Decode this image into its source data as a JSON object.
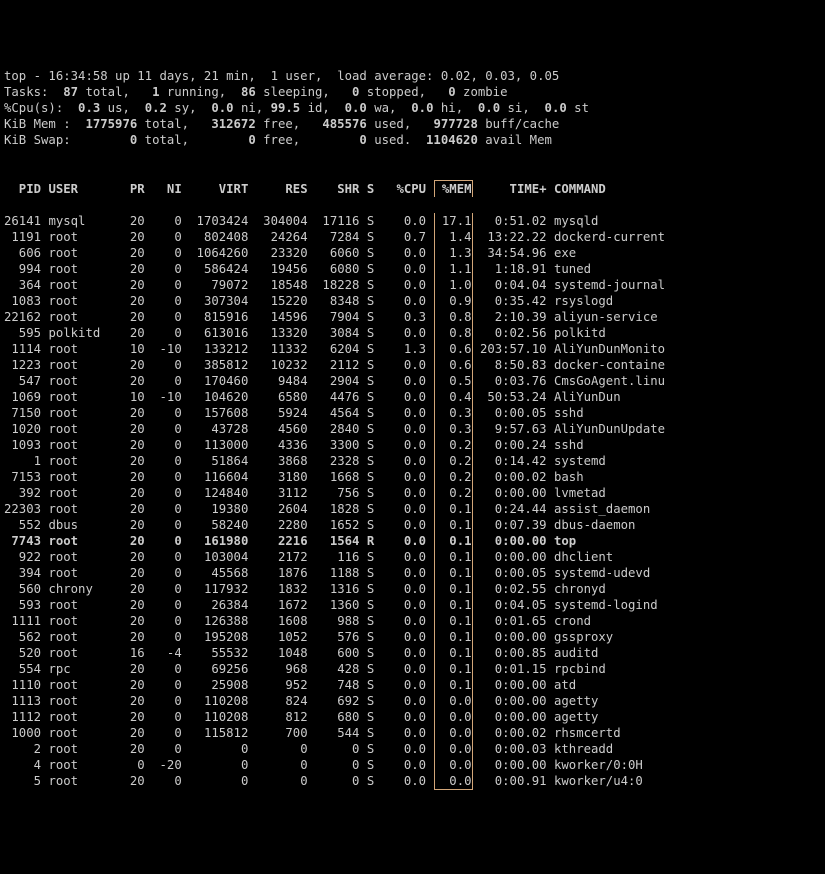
{
  "summary": {
    "top_line": {
      "time": "16:34:58",
      "uptime": "11 days, 21 min",
      "users": "1 user",
      "load": "0.02, 0.03, 0.05"
    },
    "tasks": {
      "total": "87",
      "running": "1",
      "sleeping": "86",
      "stopped": "0",
      "zombie": "0"
    },
    "cpu": {
      "us": "0.3",
      "sy": "0.2",
      "ni": "0.0",
      "id": "99.5",
      "wa": "0.0",
      "hi": "0.0",
      "si": "0.0",
      "st": "0.0"
    },
    "mem": {
      "total": "1775976",
      "free": "312672",
      "used": "485576",
      "buff": "977728"
    },
    "swap": {
      "total": "0",
      "free": "0",
      "used": "0",
      "avail": "1104620"
    }
  },
  "columns": [
    "PID",
    "USER",
    "PR",
    "NI",
    "VIRT",
    "RES",
    "SHR",
    "S",
    "%CPU",
    "%MEM",
    "TIME+",
    "COMMAND"
  ],
  "processes": [
    {
      "pid": "26141",
      "user": "mysql",
      "pr": "20",
      "ni": "0",
      "virt": "1703424",
      "res": "304004",
      "shr": "17116",
      "s": "S",
      "cpu": "0.0",
      "mem": "17.1",
      "time": "0:51.02",
      "cmd": "mysqld"
    },
    {
      "pid": "1191",
      "user": "root",
      "pr": "20",
      "ni": "0",
      "virt": "802408",
      "res": "24264",
      "shr": "7284",
      "s": "S",
      "cpu": "0.7",
      "mem": "1.4",
      "time": "13:22.22",
      "cmd": "dockerd-current"
    },
    {
      "pid": "606",
      "user": "root",
      "pr": "20",
      "ni": "0",
      "virt": "1064260",
      "res": "23320",
      "shr": "6060",
      "s": "S",
      "cpu": "0.0",
      "mem": "1.3",
      "time": "34:54.96",
      "cmd": "exe"
    },
    {
      "pid": "994",
      "user": "root",
      "pr": "20",
      "ni": "0",
      "virt": "586424",
      "res": "19456",
      "shr": "6080",
      "s": "S",
      "cpu": "0.0",
      "mem": "1.1",
      "time": "1:18.91",
      "cmd": "tuned"
    },
    {
      "pid": "364",
      "user": "root",
      "pr": "20",
      "ni": "0",
      "virt": "79072",
      "res": "18548",
      "shr": "18228",
      "s": "S",
      "cpu": "0.0",
      "mem": "1.0",
      "time": "0:04.04",
      "cmd": "systemd-journal"
    },
    {
      "pid": "1083",
      "user": "root",
      "pr": "20",
      "ni": "0",
      "virt": "307304",
      "res": "15220",
      "shr": "8348",
      "s": "S",
      "cpu": "0.0",
      "mem": "0.9",
      "time": "0:35.42",
      "cmd": "rsyslogd"
    },
    {
      "pid": "22162",
      "user": "root",
      "pr": "20",
      "ni": "0",
      "virt": "815916",
      "res": "14596",
      "shr": "7904",
      "s": "S",
      "cpu": "0.3",
      "mem": "0.8",
      "time": "2:10.39",
      "cmd": "aliyun-service"
    },
    {
      "pid": "595",
      "user": "polkitd",
      "pr": "20",
      "ni": "0",
      "virt": "613016",
      "res": "13320",
      "shr": "3084",
      "s": "S",
      "cpu": "0.0",
      "mem": "0.8",
      "time": "0:02.56",
      "cmd": "polkitd"
    },
    {
      "pid": "1114",
      "user": "root",
      "pr": "10",
      "ni": "-10",
      "virt": "133212",
      "res": "11332",
      "shr": "6204",
      "s": "S",
      "cpu": "1.3",
      "mem": "0.6",
      "time": "203:57.10",
      "cmd": "AliYunDunMonito"
    },
    {
      "pid": "1223",
      "user": "root",
      "pr": "20",
      "ni": "0",
      "virt": "385812",
      "res": "10232",
      "shr": "2112",
      "s": "S",
      "cpu": "0.0",
      "mem": "0.6",
      "time": "8:50.83",
      "cmd": "docker-containe"
    },
    {
      "pid": "547",
      "user": "root",
      "pr": "20",
      "ni": "0",
      "virt": "170460",
      "res": "9484",
      "shr": "2904",
      "s": "S",
      "cpu": "0.0",
      "mem": "0.5",
      "time": "0:03.76",
      "cmd": "CmsGoAgent.linu"
    },
    {
      "pid": "1069",
      "user": "root",
      "pr": "10",
      "ni": "-10",
      "virt": "104620",
      "res": "6580",
      "shr": "4476",
      "s": "S",
      "cpu": "0.0",
      "mem": "0.4",
      "time": "50:53.24",
      "cmd": "AliYunDun"
    },
    {
      "pid": "7150",
      "user": "root",
      "pr": "20",
      "ni": "0",
      "virt": "157608",
      "res": "5924",
      "shr": "4564",
      "s": "S",
      "cpu": "0.0",
      "mem": "0.3",
      "time": "0:00.05",
      "cmd": "sshd"
    },
    {
      "pid": "1020",
      "user": "root",
      "pr": "20",
      "ni": "0",
      "virt": "43728",
      "res": "4560",
      "shr": "2840",
      "s": "S",
      "cpu": "0.0",
      "mem": "0.3",
      "time": "9:57.63",
      "cmd": "AliYunDunUpdate"
    },
    {
      "pid": "1093",
      "user": "root",
      "pr": "20",
      "ni": "0",
      "virt": "113000",
      "res": "4336",
      "shr": "3300",
      "s": "S",
      "cpu": "0.0",
      "mem": "0.2",
      "time": "0:00.24",
      "cmd": "sshd"
    },
    {
      "pid": "1",
      "user": "root",
      "pr": "20",
      "ni": "0",
      "virt": "51864",
      "res": "3868",
      "shr": "2328",
      "s": "S",
      "cpu": "0.0",
      "mem": "0.2",
      "time": "0:14.42",
      "cmd": "systemd"
    },
    {
      "pid": "7153",
      "user": "root",
      "pr": "20",
      "ni": "0",
      "virt": "116604",
      "res": "3180",
      "shr": "1668",
      "s": "S",
      "cpu": "0.0",
      "mem": "0.2",
      "time": "0:00.02",
      "cmd": "bash"
    },
    {
      "pid": "392",
      "user": "root",
      "pr": "20",
      "ni": "0",
      "virt": "124840",
      "res": "3112",
      "shr": "756",
      "s": "S",
      "cpu": "0.0",
      "mem": "0.2",
      "time": "0:00.00",
      "cmd": "lvmetad"
    },
    {
      "pid": "22303",
      "user": "root",
      "pr": "20",
      "ni": "0",
      "virt": "19380",
      "res": "2604",
      "shr": "1828",
      "s": "S",
      "cpu": "0.0",
      "mem": "0.1",
      "time": "0:24.44",
      "cmd": "assist_daemon"
    },
    {
      "pid": "552",
      "user": "dbus",
      "pr": "20",
      "ni": "0",
      "virt": "58240",
      "res": "2280",
      "shr": "1652",
      "s": "S",
      "cpu": "0.0",
      "mem": "0.1",
      "time": "0:07.39",
      "cmd": "dbus-daemon"
    },
    {
      "pid": "7743",
      "user": "root",
      "pr": "20",
      "ni": "0",
      "virt": "161980",
      "res": "2216",
      "shr": "1564",
      "s": "R",
      "cpu": "0.0",
      "mem": "0.1",
      "time": "0:00.00",
      "cmd": "top",
      "self": true
    },
    {
      "pid": "922",
      "user": "root",
      "pr": "20",
      "ni": "0",
      "virt": "103004",
      "res": "2172",
      "shr": "116",
      "s": "S",
      "cpu": "0.0",
      "mem": "0.1",
      "time": "0:00.00",
      "cmd": "dhclient"
    },
    {
      "pid": "394",
      "user": "root",
      "pr": "20",
      "ni": "0",
      "virt": "45568",
      "res": "1876",
      "shr": "1188",
      "s": "S",
      "cpu": "0.0",
      "mem": "0.1",
      "time": "0:00.05",
      "cmd": "systemd-udevd"
    },
    {
      "pid": "560",
      "user": "chrony",
      "pr": "20",
      "ni": "0",
      "virt": "117932",
      "res": "1832",
      "shr": "1316",
      "s": "S",
      "cpu": "0.0",
      "mem": "0.1",
      "time": "0:02.55",
      "cmd": "chronyd"
    },
    {
      "pid": "593",
      "user": "root",
      "pr": "20",
      "ni": "0",
      "virt": "26384",
      "res": "1672",
      "shr": "1360",
      "s": "S",
      "cpu": "0.0",
      "mem": "0.1",
      "time": "0:04.05",
      "cmd": "systemd-logind"
    },
    {
      "pid": "1111",
      "user": "root",
      "pr": "20",
      "ni": "0",
      "virt": "126388",
      "res": "1608",
      "shr": "988",
      "s": "S",
      "cpu": "0.0",
      "mem": "0.1",
      "time": "0:01.65",
      "cmd": "crond"
    },
    {
      "pid": "562",
      "user": "root",
      "pr": "20",
      "ni": "0",
      "virt": "195208",
      "res": "1052",
      "shr": "576",
      "s": "S",
      "cpu": "0.0",
      "mem": "0.1",
      "time": "0:00.00",
      "cmd": "gssproxy"
    },
    {
      "pid": "520",
      "user": "root",
      "pr": "16",
      "ni": "-4",
      "virt": "55532",
      "res": "1048",
      "shr": "600",
      "s": "S",
      "cpu": "0.0",
      "mem": "0.1",
      "time": "0:00.85",
      "cmd": "auditd"
    },
    {
      "pid": "554",
      "user": "rpc",
      "pr": "20",
      "ni": "0",
      "virt": "69256",
      "res": "968",
      "shr": "428",
      "s": "S",
      "cpu": "0.0",
      "mem": "0.1",
      "time": "0:01.15",
      "cmd": "rpcbind"
    },
    {
      "pid": "1110",
      "user": "root",
      "pr": "20",
      "ni": "0",
      "virt": "25908",
      "res": "952",
      "shr": "748",
      "s": "S",
      "cpu": "0.0",
      "mem": "0.1",
      "time": "0:00.00",
      "cmd": "atd"
    },
    {
      "pid": "1113",
      "user": "root",
      "pr": "20",
      "ni": "0",
      "virt": "110208",
      "res": "824",
      "shr": "692",
      "s": "S",
      "cpu": "0.0",
      "mem": "0.0",
      "time": "0:00.00",
      "cmd": "agetty"
    },
    {
      "pid": "1112",
      "user": "root",
      "pr": "20",
      "ni": "0",
      "virt": "110208",
      "res": "812",
      "shr": "680",
      "s": "S",
      "cpu": "0.0",
      "mem": "0.0",
      "time": "0:00.00",
      "cmd": "agetty"
    },
    {
      "pid": "1000",
      "user": "root",
      "pr": "20",
      "ni": "0",
      "virt": "115812",
      "res": "700",
      "shr": "544",
      "s": "S",
      "cpu": "0.0",
      "mem": "0.0",
      "time": "0:00.02",
      "cmd": "rhsmcertd"
    },
    {
      "pid": "2",
      "user": "root",
      "pr": "20",
      "ni": "0",
      "virt": "0",
      "res": "0",
      "shr": "0",
      "s": "S",
      "cpu": "0.0",
      "mem": "0.0",
      "time": "0:00.03",
      "cmd": "kthreadd"
    },
    {
      "pid": "4",
      "user": "root",
      "pr": "0",
      "ni": "-20",
      "virt": "0",
      "res": "0",
      "shr": "0",
      "s": "S",
      "cpu": "0.0",
      "mem": "0.0",
      "time": "0:00.00",
      "cmd": "kworker/0:0H"
    },
    {
      "pid": "5",
      "user": "root",
      "pr": "20",
      "ni": "0",
      "virt": "0",
      "res": "0",
      "shr": "0",
      "s": "S",
      "cpu": "0.0",
      "mem": "0.0",
      "time": "0:00.91",
      "cmd": "kworker/u4:0"
    }
  ]
}
